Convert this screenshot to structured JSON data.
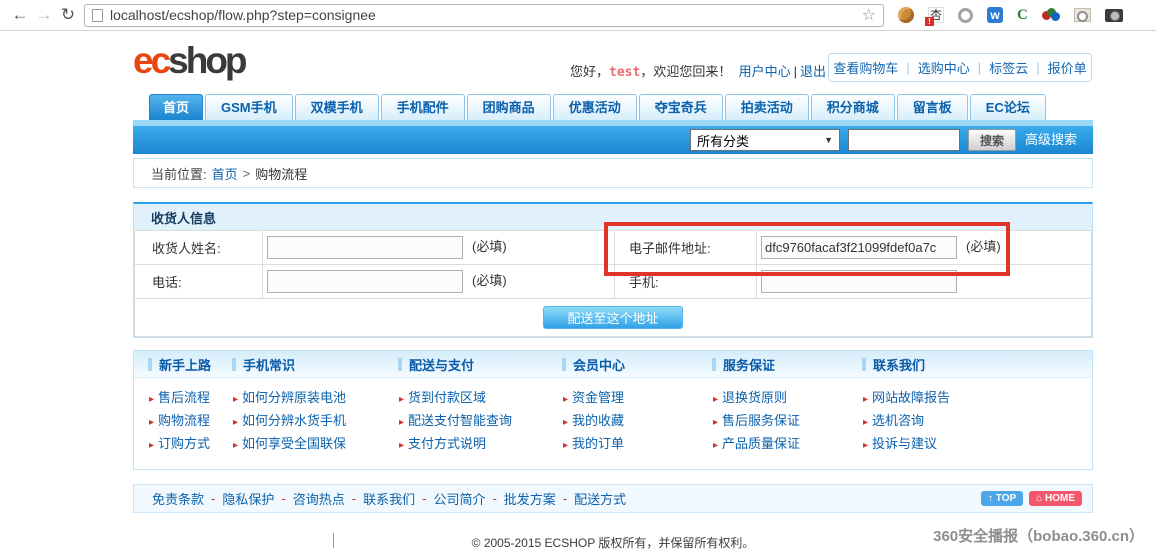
{
  "browser": {
    "url": "localhost/ecshop/flow.php?step=consignee",
    "back_glyph": "←",
    "forward_glyph": "→",
    "reload_glyph": "↻",
    "star_glyph": "☆",
    "ext_char_icon": "杏",
    "ext_char_badge": "!",
    "w_icon": "w",
    "c_icon": "C"
  },
  "header": {
    "logo_ec": "ec",
    "logo_shop": "shop",
    "greeting_prefix": "您好，",
    "username": "test",
    "greeting_suffix": "，欢迎您回来！",
    "user_center": "用户中心",
    "user_separator": "|",
    "logout": "退出",
    "quick_separator": "|",
    "quick_links": [
      "查看购物车",
      "选购中心",
      "标签云",
      "报价单"
    ]
  },
  "nav": {
    "tabs": [
      "首页",
      "GSM手机",
      "双模手机",
      "手机配件",
      "团购商品",
      "优惠活动",
      "夺宝奇兵",
      "拍卖活动",
      "积分商城",
      "留言板",
      "EC论坛"
    ]
  },
  "search": {
    "category": "所有分类",
    "dropdown_arrow": "▼",
    "button": "搜索",
    "advanced": "高级搜索"
  },
  "breadcrumb": {
    "label": "当前位置:",
    "home": "首页",
    "separator": ">",
    "current": "购物流程"
  },
  "form": {
    "title": "收货人信息",
    "name_label": "收货人姓名:",
    "phone_label": "电话:",
    "email_label": "电子邮件地址:",
    "mobile_label": "手机:",
    "email_value": "dfc9760facaf3f21099fdef0a7c",
    "required": "(必填)",
    "submit": "配送至这个地址"
  },
  "help": {
    "marker": "▸",
    "columns": [
      {
        "title": "新手上路",
        "links": [
          "售后流程",
          "购物流程",
          "订购方式"
        ]
      },
      {
        "title": "手机常识",
        "links": [
          "如何分辨原装电池",
          "如何分辨水货手机",
          "如何享受全国联保"
        ]
      },
      {
        "title": "配送与支付",
        "links": [
          "货到付款区域",
          "配送支付智能查询",
          "支付方式说明"
        ]
      },
      {
        "title": "会员中心",
        "links": [
          "资金管理",
          "我的收藏",
          "我的订单"
        ]
      },
      {
        "title": "服务保证",
        "links": [
          "退换货原则",
          "售后服务保证",
          "产品质量保证"
        ]
      },
      {
        "title": "联系我们",
        "links": [
          "网站故障报告",
          "选机咨询",
          "投诉与建议"
        ]
      }
    ]
  },
  "footer": {
    "links": [
      "免责条款",
      "隐私保护",
      "咨询热点",
      "联系我们",
      "公司简介",
      "批发方案",
      "配送方式"
    ],
    "separator": "-",
    "top_button": "↑ TOP",
    "home_button": "⌂ HOME",
    "copyright": "© 2005-2015 ECSHOP 版权所有，并保留所有权利。"
  },
  "watermark": "360安全播报（bobao.360.cn）",
  "colors": {
    "band_blue": "#1c86d0",
    "link_blue": "#0b61ad",
    "highlight_red": "#e0332a",
    "top_button_blue": "#4ba7ea",
    "home_button_red": "#f4566c",
    "logo_orange": "#e8470f"
  }
}
